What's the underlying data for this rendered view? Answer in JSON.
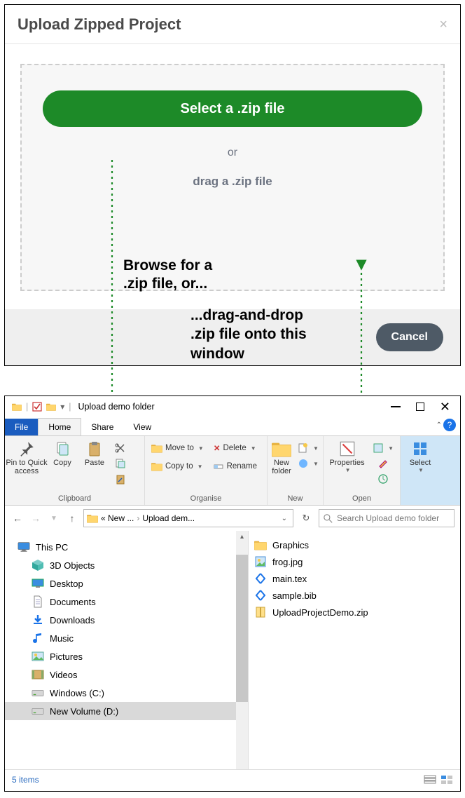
{
  "dialog": {
    "title": "Upload Zipped Project",
    "select_label": "Select a .zip file",
    "or_label": "or",
    "drag_label": "drag a .zip file",
    "cancel_label": "Cancel"
  },
  "annotations": {
    "browse": "Browse for a\n.zip file, or...",
    "drag": "...drag-and-drop\n.zip file onto this\nwindow"
  },
  "explorer": {
    "window_title": "Upload demo folder",
    "tabs": {
      "file": "File",
      "home": "Home",
      "share": "Share",
      "view": "View"
    },
    "ribbon": {
      "clipboard": {
        "pin": "Pin to Quick\naccess",
        "copy": "Copy",
        "paste": "Paste",
        "group": "Clipboard"
      },
      "organise": {
        "moveto": "Move to",
        "copyto": "Copy to",
        "delete": "Delete",
        "rename": "Rename",
        "group": "Organise"
      },
      "new": {
        "newfolder": "New\nfolder",
        "group": "New"
      },
      "open": {
        "properties": "Properties",
        "group": "Open"
      },
      "select": {
        "select": "Select",
        "group": ""
      }
    },
    "address": {
      "seg1": "« New ...",
      "seg2": "Upload dem...",
      "search_placeholder": "Search Upload demo folder"
    },
    "nav": [
      {
        "label": "This PC",
        "key": "this-pc"
      },
      {
        "label": "3D Objects",
        "key": "3d-objects"
      },
      {
        "label": "Desktop",
        "key": "desktop"
      },
      {
        "label": "Documents",
        "key": "documents"
      },
      {
        "label": "Downloads",
        "key": "downloads"
      },
      {
        "label": "Music",
        "key": "music"
      },
      {
        "label": "Pictures",
        "key": "pictures"
      },
      {
        "label": "Videos",
        "key": "videos"
      },
      {
        "label": "Windows (C:)",
        "key": "drive-c"
      },
      {
        "label": "New Volume (D:)",
        "key": "drive-d"
      }
    ],
    "files": [
      {
        "label": "Graphics",
        "type": "folder"
      },
      {
        "label": "frog.jpg",
        "type": "jpg"
      },
      {
        "label": "main.tex",
        "type": "tex"
      },
      {
        "label": "sample.bib",
        "type": "bib"
      },
      {
        "label": "UploadProjectDemo.zip",
        "type": "zip"
      }
    ],
    "status": "5 items"
  }
}
